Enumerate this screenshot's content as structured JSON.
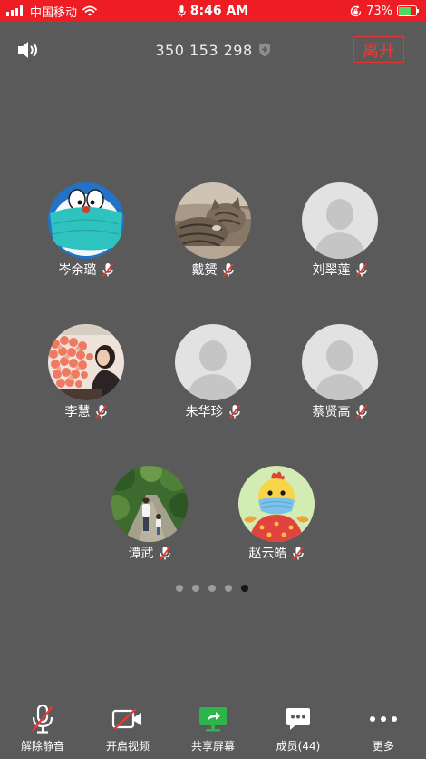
{
  "status_bar": {
    "carrier": "中国移动",
    "time": "8:46 AM",
    "battery_percent": "73%"
  },
  "header": {
    "meeting_id": "350 153 298",
    "leave_label": "离开"
  },
  "participants": [
    {
      "name": "岑余璐",
      "muted": true
    },
    {
      "name": "戴赟",
      "muted": true
    },
    {
      "name": "刘翠莲",
      "muted": true
    },
    {
      "name": "李慧",
      "muted": true
    },
    {
      "name": "朱华珍",
      "muted": true
    },
    {
      "name": "蔡贤高",
      "muted": true
    },
    {
      "name": "谭武",
      "muted": true
    },
    {
      "name": "赵云皓",
      "muted": true
    }
  ],
  "pagination": {
    "total_pages": 5,
    "current_page": 5
  },
  "toolbar": [
    {
      "label": "解除静音",
      "icon": "mic-muted-icon"
    },
    {
      "label": "开启视频",
      "icon": "video-off-icon"
    },
    {
      "label": "共享屏幕",
      "icon": "share-screen-icon"
    },
    {
      "label": "成员(44)",
      "icon": "members-icon"
    },
    {
      "label": "更多",
      "icon": "more-icon"
    }
  ],
  "colors": {
    "status_bar": "#ee1d23",
    "background": "#5a5a5a",
    "leave_accent": "#e8342f",
    "mute_slash": "#e53935",
    "share_green": "#2db44b",
    "active_dot": "#151515",
    "inactive_dot": "#9b9b9b"
  }
}
